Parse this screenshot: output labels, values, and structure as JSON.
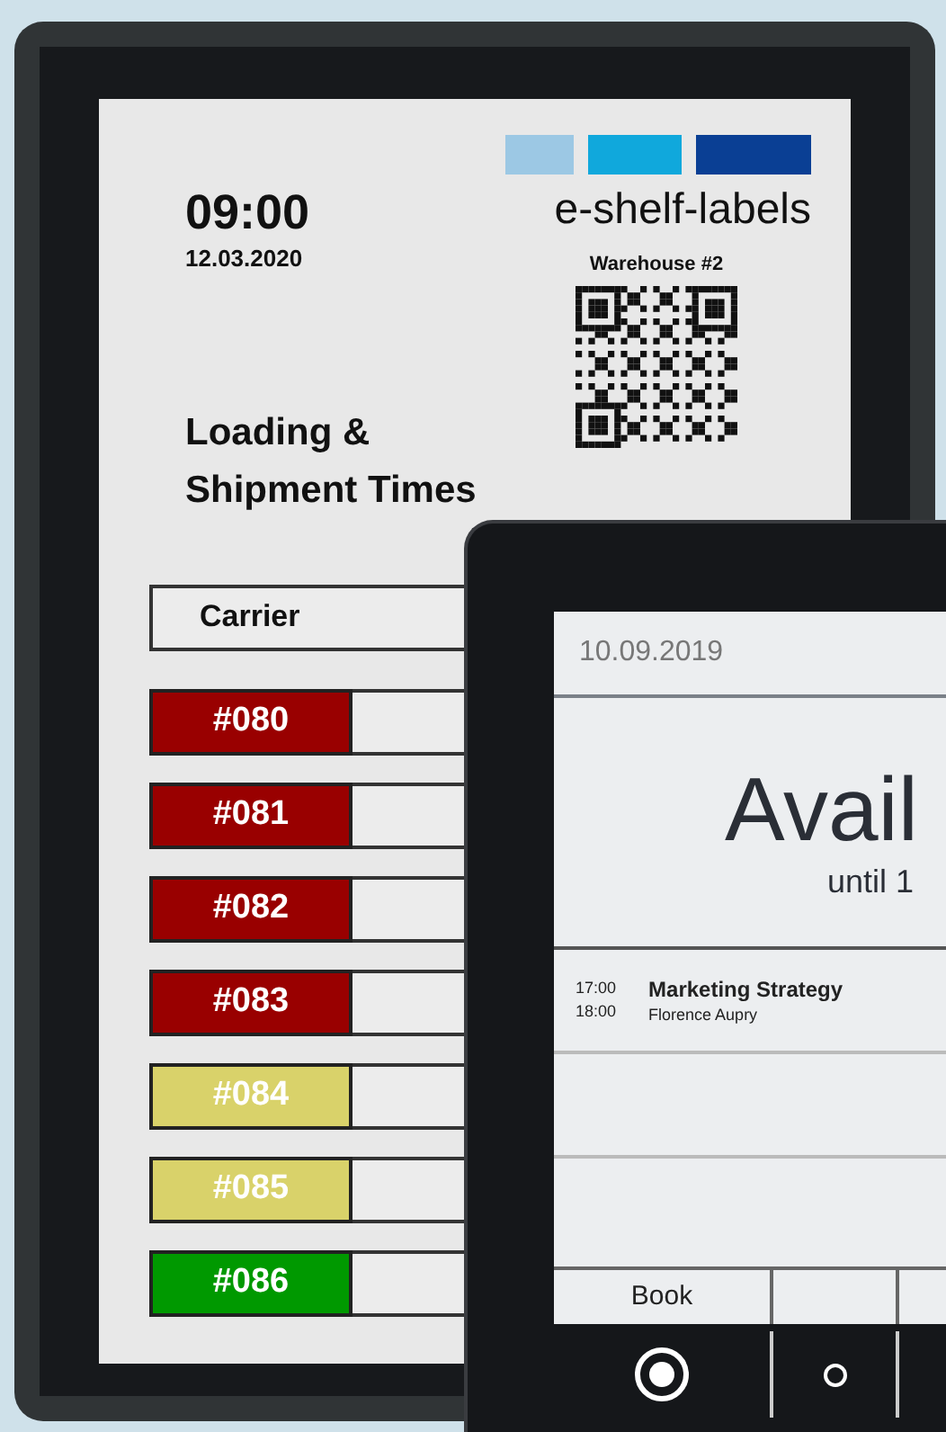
{
  "label_display": {
    "time": "09:00",
    "date": "12.03.2020",
    "brand": "e-shelf-labels",
    "location": "Warehouse #2",
    "title_lines": [
      "Loading &",
      "Shipment Times"
    ],
    "table": {
      "header": "Carrier",
      "rows": [
        {
          "carrier": "#080",
          "color": "#990000"
        },
        {
          "carrier": "#081",
          "color": "#990000"
        },
        {
          "carrier": "#082",
          "color": "#990000"
        },
        {
          "carrier": "#083",
          "color": "#990000"
        },
        {
          "carrier": "#084",
          "color": "#d9d26a"
        },
        {
          "carrier": "#085",
          "color": "#d9d26a"
        },
        {
          "carrier": "#086",
          "color": "#009900"
        }
      ]
    }
  },
  "room_display": {
    "date": "10.09.2019",
    "status": "Avail",
    "until": "until 1",
    "events": [
      {
        "start": "17:00",
        "end": "18:00",
        "title": "Marketing Strategy",
        "organizer": "Florence Aupry"
      }
    ],
    "buttons": [
      "Book"
    ]
  }
}
